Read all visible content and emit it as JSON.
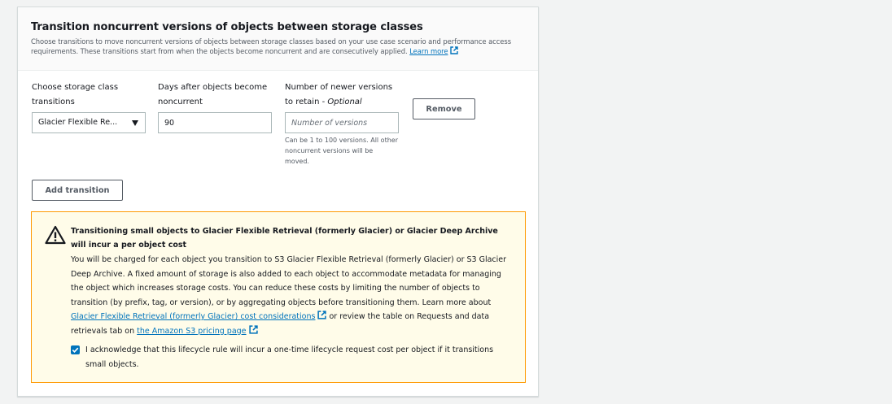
{
  "section": {
    "title": "Transition noncurrent versions of objects between storage classes",
    "description": "Choose transitions to move noncurrent versions of objects between storage classes based on your use case scenario and performance access requirements. These transitions start from when the objects become noncurrent and are consecutively applied.",
    "learn_more": "Learn more"
  },
  "form": {
    "storage_class_label_line1": "Choose storage class",
    "storage_class_label_line2": "transitions",
    "storage_class_value": "Glacier Flexible Re...",
    "days_label_line1": "Days after objects become",
    "days_label_line2": "noncurrent",
    "days_value": "90",
    "versions_label_line1": "Number of newer versions",
    "versions_label_line2": "to retain - ",
    "versions_optional": "Optional",
    "versions_placeholder": "Number of versions",
    "versions_hint": "Can be 1 to 100 versions. All other noncurrent versions will be moved.",
    "remove_label": "Remove",
    "add_transition_label": "Add transition"
  },
  "alert": {
    "title": "Transitioning small objects to Glacier Flexible Retrieval (formerly Glacier) or Glacier Deep Archive will incur a per object cost",
    "body_text": "You will be charged for each object you transition to S3 Glacier Flexible Retrieval (formerly Glacier) or S3 Glacier Deep Archive. A fixed amount of storage is also added to each object to accommodate metadata for managing the object which increases storage costs. You can reduce these costs by limiting the number of objects to transition (by prefix, tag, or version), or by aggregating objects before transitioning them. Learn more about",
    "cost_link": "Glacier Flexible Retrieval (formerly Glacier) cost considerations",
    "body_mid": "or review the table on Requests and data retrievals tab on",
    "pricing_link": "the Amazon S3 pricing page",
    "ack_text": "I acknowledge that this lifecycle rule will incur a one-time lifecycle request cost per object if it transitions small objects.",
    "ack_checked": true
  },
  "colors": {
    "link": "#0073bb",
    "warning_border": "#ff9900",
    "warning_bg": "#fffce9",
    "checkbox": "#0073bb"
  }
}
